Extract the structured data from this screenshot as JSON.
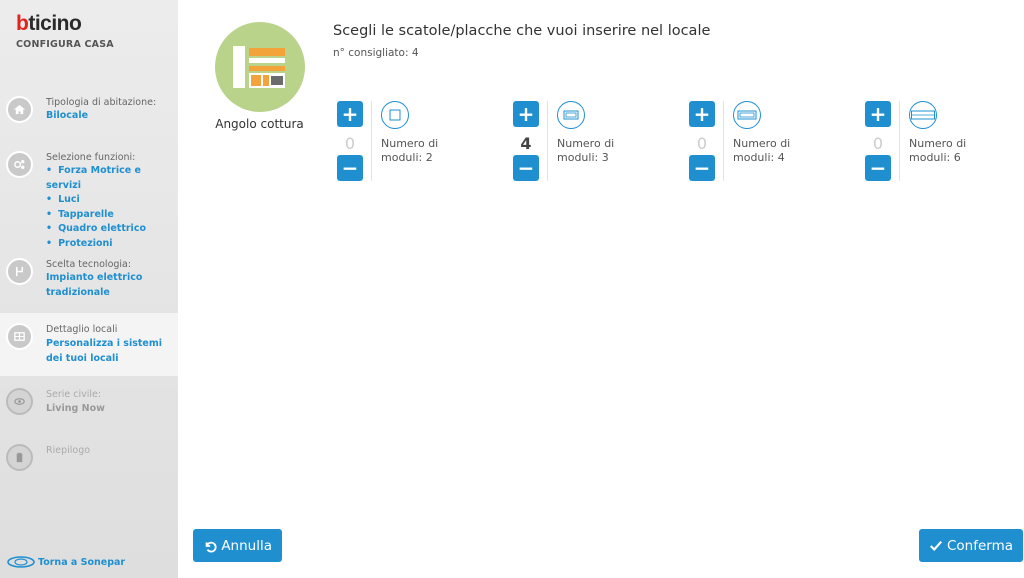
{
  "sidebar": {
    "logo_first": "b",
    "logo_rest": "ticino",
    "subtitle": "CONFIGURA CASA",
    "steps": [
      {
        "label": "Tipologia di abitazione:",
        "value": "Bilocale"
      },
      {
        "label": "Selezione funzioni:",
        "items": [
          "Forza Motrice e servizi",
          "Luci",
          "Tapparelle",
          "Quadro elettrico",
          "Protezioni"
        ]
      },
      {
        "label": "Scelta tecnologia:",
        "value": "Impianto elettrico tradizionale"
      },
      {
        "label": "Dettaglio locali",
        "value": "Personalizza i sistemi dei tuoi locali"
      },
      {
        "label": "Serie civile:",
        "value": "Living Now"
      },
      {
        "label": "Riepilogo"
      }
    ],
    "footer_link": "Torna a Sonepar"
  },
  "room": {
    "name": "Angolo cottura"
  },
  "main": {
    "title": "Scegli le scatole/placche che vuoi inserire nel locale",
    "hint": "n° consigliato: 4",
    "groups": [
      {
        "count": "0",
        "line1": "Numero di",
        "line2": "moduli: 2"
      },
      {
        "count": "4",
        "line1": "Numero di",
        "line2": "moduli: 3"
      },
      {
        "count": "0",
        "line1": "Numero di",
        "line2": "moduli: 4"
      },
      {
        "count": "0",
        "line1": "Numero di",
        "line2": "moduli: 6"
      }
    ],
    "plus": "+",
    "minus": "−"
  },
  "actions": {
    "cancel": "Annulla",
    "confirm": "Conferma"
  },
  "colors": {
    "accent": "#1f8fd0",
    "brand_red": "#e2231a",
    "room_circle": "#b9d38a"
  }
}
